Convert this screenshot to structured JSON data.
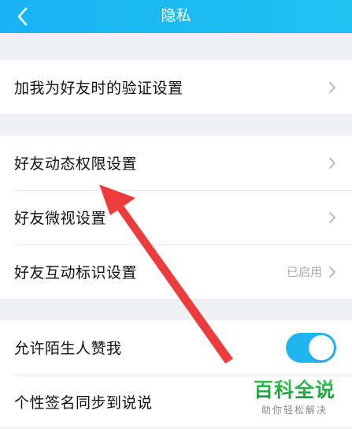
{
  "colors": {
    "header_start": "#18b3f4",
    "header_end": "#21c2f2",
    "toggle_on": "#1fb5f0",
    "annotation_arrow": "#ec3c3c",
    "watermark_green": "#1f9e3e"
  },
  "header": {
    "back_icon": "chevron-left-icon",
    "title": "隐私"
  },
  "sections": [
    {
      "items": [
        {
          "label": "加我为好友时的验证设置",
          "accessory": "chevron-right-icon"
        }
      ]
    },
    {
      "items": [
        {
          "label": "好友动态权限设置",
          "accessory": "chevron-right-icon"
        },
        {
          "label": "好友微视设置",
          "accessory": "chevron-right-icon"
        },
        {
          "label": "好友互动标识设置",
          "status": "已启用",
          "accessory": "chevron-right-icon"
        }
      ]
    },
    {
      "items": [
        {
          "label": "允许陌生人赞我",
          "toggle_on": true
        },
        {
          "label": "个性签名同步到说说"
        }
      ]
    }
  ],
  "annotation": {
    "type": "arrow",
    "points_to": "好友动态权限设置"
  },
  "watermark": {
    "title": "百科全说",
    "subtitle": "助你轻松解决"
  }
}
